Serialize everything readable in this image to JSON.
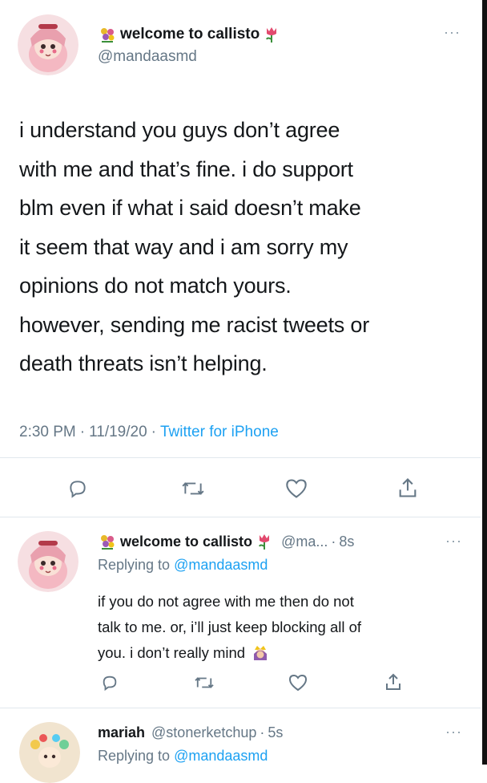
{
  "main_tweet": {
    "display_name": "welcome to callisto",
    "handle": "@mandaasmd",
    "text_lines": [
      "i understand you guys don’t agree",
      "with me and that’s fine. i do support",
      "blm even if what i said doesn’t make",
      "it seem that way and i am sorry my",
      "opinions do not match yours.",
      "however, sending me racist tweets or",
      "death threats isn’t helping."
    ],
    "time": "2:30 PM",
    "date": "11/19/20",
    "source": "Twitter for iPhone",
    "more": "···"
  },
  "reply_1": {
    "display_name": "welcome to callisto",
    "handle": "@ma...",
    "age": "8s",
    "replying_prefix": "Replying to",
    "replying_handle": "@mandaasmd",
    "text_lines": [
      "if you do not agree with me then do not",
      "talk to me. or, i’ll just keep blocking all of",
      "you. i don’t really mind"
    ],
    "more": "···"
  },
  "reply_2": {
    "display_name": "mariah",
    "handle": "@stonerketchup",
    "age": "5s",
    "replying_prefix": "Replying to",
    "replying_handle": "@mandaasmd",
    "more": "···"
  },
  "separator_dot": "·",
  "icons": [
    "reply-icon",
    "retweet-icon",
    "like-icon",
    "share-icon",
    "flower-emoji-icon",
    "tulip-emoji-icon",
    "princess-emoji-icon"
  ],
  "colors": {
    "link": "#1da1f2",
    "muted": "#657786",
    "text": "#14171a",
    "divider": "#e1e8ed"
  }
}
